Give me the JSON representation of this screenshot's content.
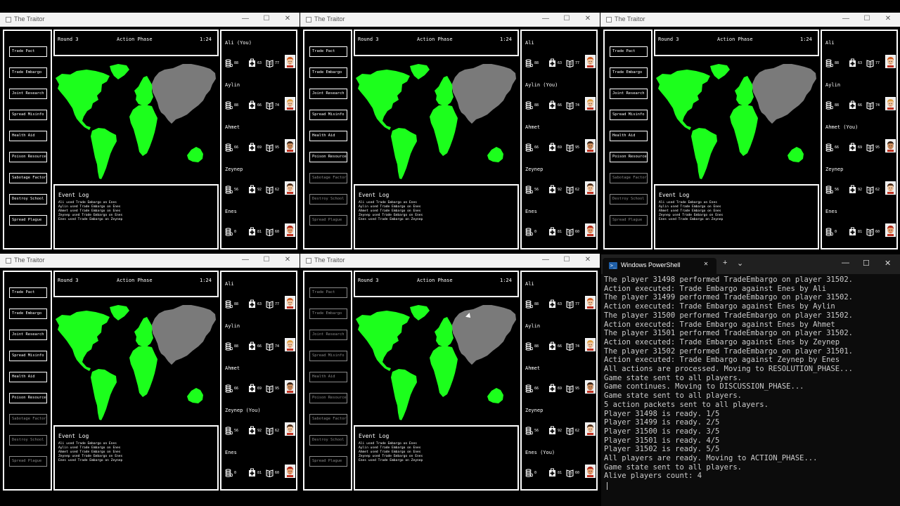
{
  "game_title": "The Traitor",
  "window_controls": [
    "—",
    "☐",
    "✕"
  ],
  "round_label": "Round 3",
  "phase_label": "Action Phase",
  "timer": "1:24",
  "event_log_title": "Event Log",
  "event_log_lines": [
    "Ali used Trade Embargo on Enes",
    "Aylin used Trade Embargo on Enes",
    "Ahmet used Trade Embargo on Enes",
    "Zeynep used Trade Embargo on Enes",
    "Enes used Trade Embargo on Zeynep"
  ],
  "actions": [
    "Trade Pact",
    "Trade Embargo",
    "Joint Research",
    "Spread Misinfo",
    "Health Aid",
    "Poison Resources",
    "Sabotage Factory",
    "Destroy School",
    "Spread Plague"
  ],
  "windows": [
    {
      "players": [
        "Ali (You)",
        "Aylin",
        "Ahmet",
        "Zeynep",
        "Enes"
      ],
      "disabled": []
    },
    {
      "players": [
        "Ali",
        "Aylin (You)",
        "Ahmet",
        "Zeynep",
        "Enes"
      ],
      "disabled": [
        6,
        7,
        8
      ]
    },
    {
      "players": [
        "Ali",
        "Aylin",
        "Ahmet (You)",
        "Zeynep",
        "Enes"
      ],
      "disabled": [
        6,
        7,
        8
      ]
    },
    {
      "players": [
        "Ali",
        "Aylin",
        "Ahmet",
        "Zeynep (You)",
        "Enes"
      ],
      "disabled": [
        6,
        7,
        8
      ]
    },
    {
      "players": [
        "Ali",
        "Aylin",
        "Ahmet",
        "Zeynep",
        "Enes (You)"
      ],
      "disabled": [
        0,
        1,
        2,
        3,
        4,
        5,
        6,
        7,
        8
      ]
    }
  ],
  "player_stats": [
    {
      "economy": "88",
      "health": "63",
      "education": "77",
      "avatar_skin": "#f2c49c",
      "avatar_hair": "#d45a1e"
    },
    {
      "economy": "88",
      "health": "66",
      "education": "74",
      "avatar_skin": "#f2c49c",
      "avatar_hair": "#e0a040"
    },
    {
      "economy": "66",
      "health": "69",
      "education": "95",
      "avatar_skin": "#c98a5a",
      "avatar_hair": "#3a2416"
    },
    {
      "economy": "56",
      "health": "92",
      "education": "62",
      "avatar_skin": "#f2c49c",
      "avatar_hair": "#4a2a14"
    },
    {
      "economy": "0",
      "health": "81",
      "education": "60",
      "avatar_skin": "#e8a070",
      "avatar_hair": "#b02010"
    }
  ],
  "colors": {
    "land_active": "#1cff1c",
    "land_inactive": "#7a7a7a",
    "panel_border": "#ffffff",
    "disabled": "#8a8a8a"
  },
  "icons": {
    "economy": "coin-stack-icon",
    "health": "medkit-icon",
    "education": "book-icon"
  },
  "powershell": {
    "tab_title": "Windows PowerShell",
    "tab_close": "✕",
    "new_tab": "+",
    "dropdown": "⌄",
    "minimize": "—",
    "maximize": "☐",
    "close": "✕",
    "lines": [
      "The player 31498 performed TradeEmbargo on player 31502.",
      "Action executed: Trade Embargo against Enes by Ali",
      "The player 31499 performed TradeEmbargo on player 31502.",
      "Action executed: Trade Embargo against Enes by Aylin",
      "The player 31500 performed TradeEmbargo on player 31502.",
      "Action executed: Trade Embargo against Enes by Ahmet",
      "The player 31501 performed TradeEmbargo on player 31502.",
      "Action executed: Trade Embargo against Enes by Zeynep",
      "The player 31502 performed TradeEmbargo on player 31501.",
      "Action executed: Trade Embargo against Zeynep by Enes",
      "All actions are processed. Moving to RESOLUTION_PHASE...",
      "Game state sent to all players.",
      "Game continues. Moving to DISCUSSION_PHASE...",
      "Game state sent to all players.",
      "5 action packets sent to all players.",
      "Player 31498 is ready. 1/5",
      "Player 31499 is ready. 2/5",
      "Player 31500 is ready. 3/5",
      "Player 31501 is ready. 4/5",
      "Player 31502 is ready. 5/5",
      "All players are ready. Moving to ACTION_PHASE...",
      "Game state sent to all players.",
      "Alive players count: 4"
    ]
  }
}
